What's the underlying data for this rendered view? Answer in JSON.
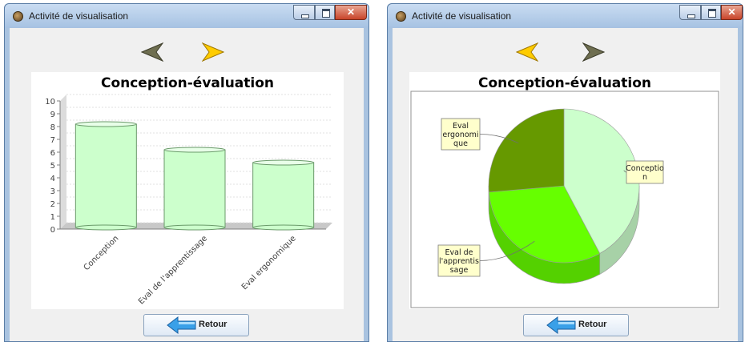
{
  "windows": [
    {
      "title": "Activité de visualisation",
      "retour_label": "Retour",
      "chart_data": {
        "type": "bar",
        "title": "Conception-évaluation",
        "categories": [
          "Conception",
          "Eval de l'apprentissage",
          "Eval ergonomique"
        ],
        "values": [
          8,
          6,
          5
        ],
        "ylim": [
          0,
          10
        ],
        "yticks": [
          "0",
          "1",
          "2",
          "3",
          "4",
          "5",
          "6",
          "7",
          "8",
          "9",
          "10"
        ],
        "bar_color": "#ccffcc"
      }
    },
    {
      "title": "Activité de visualisation",
      "retour_label": "Retour",
      "chart_data": {
        "type": "pie",
        "title": "Conception-évaluation",
        "slices": [
          {
            "label": "Conception",
            "value": 8,
            "color": "#ccffcc",
            "label_lines": [
              "Conceptio",
              "n"
            ]
          },
          {
            "label": "Eval de l'apprentissage",
            "value": 6,
            "color": "#66ff00",
            "label_lines": [
              "Eval de",
              "l'apprentis",
              "sage"
            ]
          },
          {
            "label": "Eval ergonomique",
            "value": 5,
            "color": "#669900",
            "label_lines": [
              "Eval",
              "ergonomi",
              "que"
            ]
          }
        ]
      }
    }
  ],
  "colors": {
    "arrow_active": "#ffcc00",
    "arrow_inactive": "#6e6e50",
    "label_box": "#ffffcc"
  }
}
